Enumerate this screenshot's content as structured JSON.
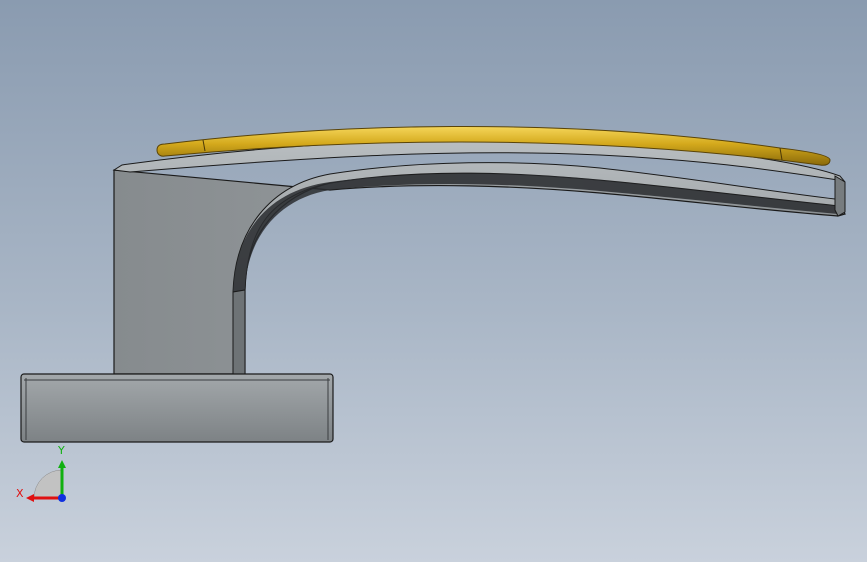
{
  "viewport": {
    "background_top": "#8a9bb0",
    "background_bottom": "#c9d1dc"
  },
  "model": {
    "body_color": "#8e9396",
    "edge_color": "#1a1a1a",
    "accent_color": "#c9a21a"
  },
  "triad": {
    "x_label": "X",
    "y_label": "Y",
    "x_color": "#e01010",
    "y_color": "#10b010",
    "z_color": "#1030e0"
  }
}
